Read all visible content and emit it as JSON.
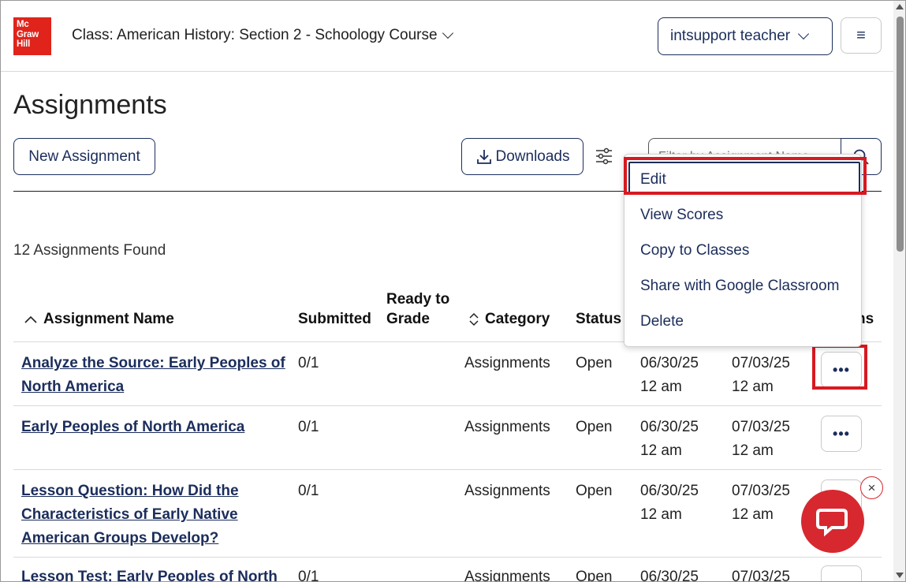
{
  "header": {
    "logo_lines": [
      "Mc",
      "Graw",
      "Hill"
    ],
    "class_title": "Class: American History: Section 2 - Schoology Course",
    "user_name": "intsupport teacher",
    "menu_glyph": "≡"
  },
  "page": {
    "title": "Assignments",
    "new_assignment_label": "New Assignment",
    "downloads_label": "Downloads",
    "search_placeholder": "Filter by Assignment Name",
    "results_count": "12 Assignments Found"
  },
  "table": {
    "columns": {
      "name": "Assignment Name",
      "submitted": "Submitted",
      "ready_line1": "Ready to",
      "ready_line2": "Grade",
      "category": "Category",
      "status": "Status",
      "actions_fragment": "ns"
    },
    "rows": [
      {
        "name_lines": [
          "Analyze the Source: Early Peoples of",
          "North America"
        ],
        "submitted": "0/1",
        "category": "Assignments",
        "status": "Open",
        "start_date": "06/30/25",
        "start_time": "12 am",
        "due_date": "07/03/25",
        "due_time": "12 am",
        "actions": "•••"
      },
      {
        "name_lines": [
          "Early Peoples of North America"
        ],
        "submitted": "0/1",
        "category": "Assignments",
        "status": "Open",
        "start_date": "06/30/25",
        "start_time": "12 am",
        "due_date": "07/03/25",
        "due_time": "12 am",
        "actions": "•••"
      },
      {
        "name_lines": [
          "Lesson Question: How Did the",
          "Characteristics of Early Native",
          "American Groups Develop?"
        ],
        "submitted": "0/1",
        "category": "Assignments",
        "status": "Open",
        "start_date": "06/30/25",
        "start_time": "12 am",
        "due_date": "07/03/25",
        "due_time": "12 am",
        "actions": "•••"
      },
      {
        "name_lines": [
          "Lesson Test: Early Peoples of North"
        ],
        "submitted": "0/1",
        "category": "Assignments",
        "status": "Open",
        "start_date": "06/30/25",
        "start_time": "",
        "due_date": "07/03/25",
        "due_time": "",
        "actions": "•••"
      }
    ]
  },
  "dropdown": {
    "items": [
      "Edit",
      "View Scores",
      "Copy to Classes",
      "Share with Google Classroom",
      "Delete"
    ]
  },
  "chat": {
    "close_glyph": "×"
  },
  "colors": {
    "brand_red": "#e0241b",
    "navy": "#1b2d5b",
    "highlight_red": "#d71921"
  }
}
